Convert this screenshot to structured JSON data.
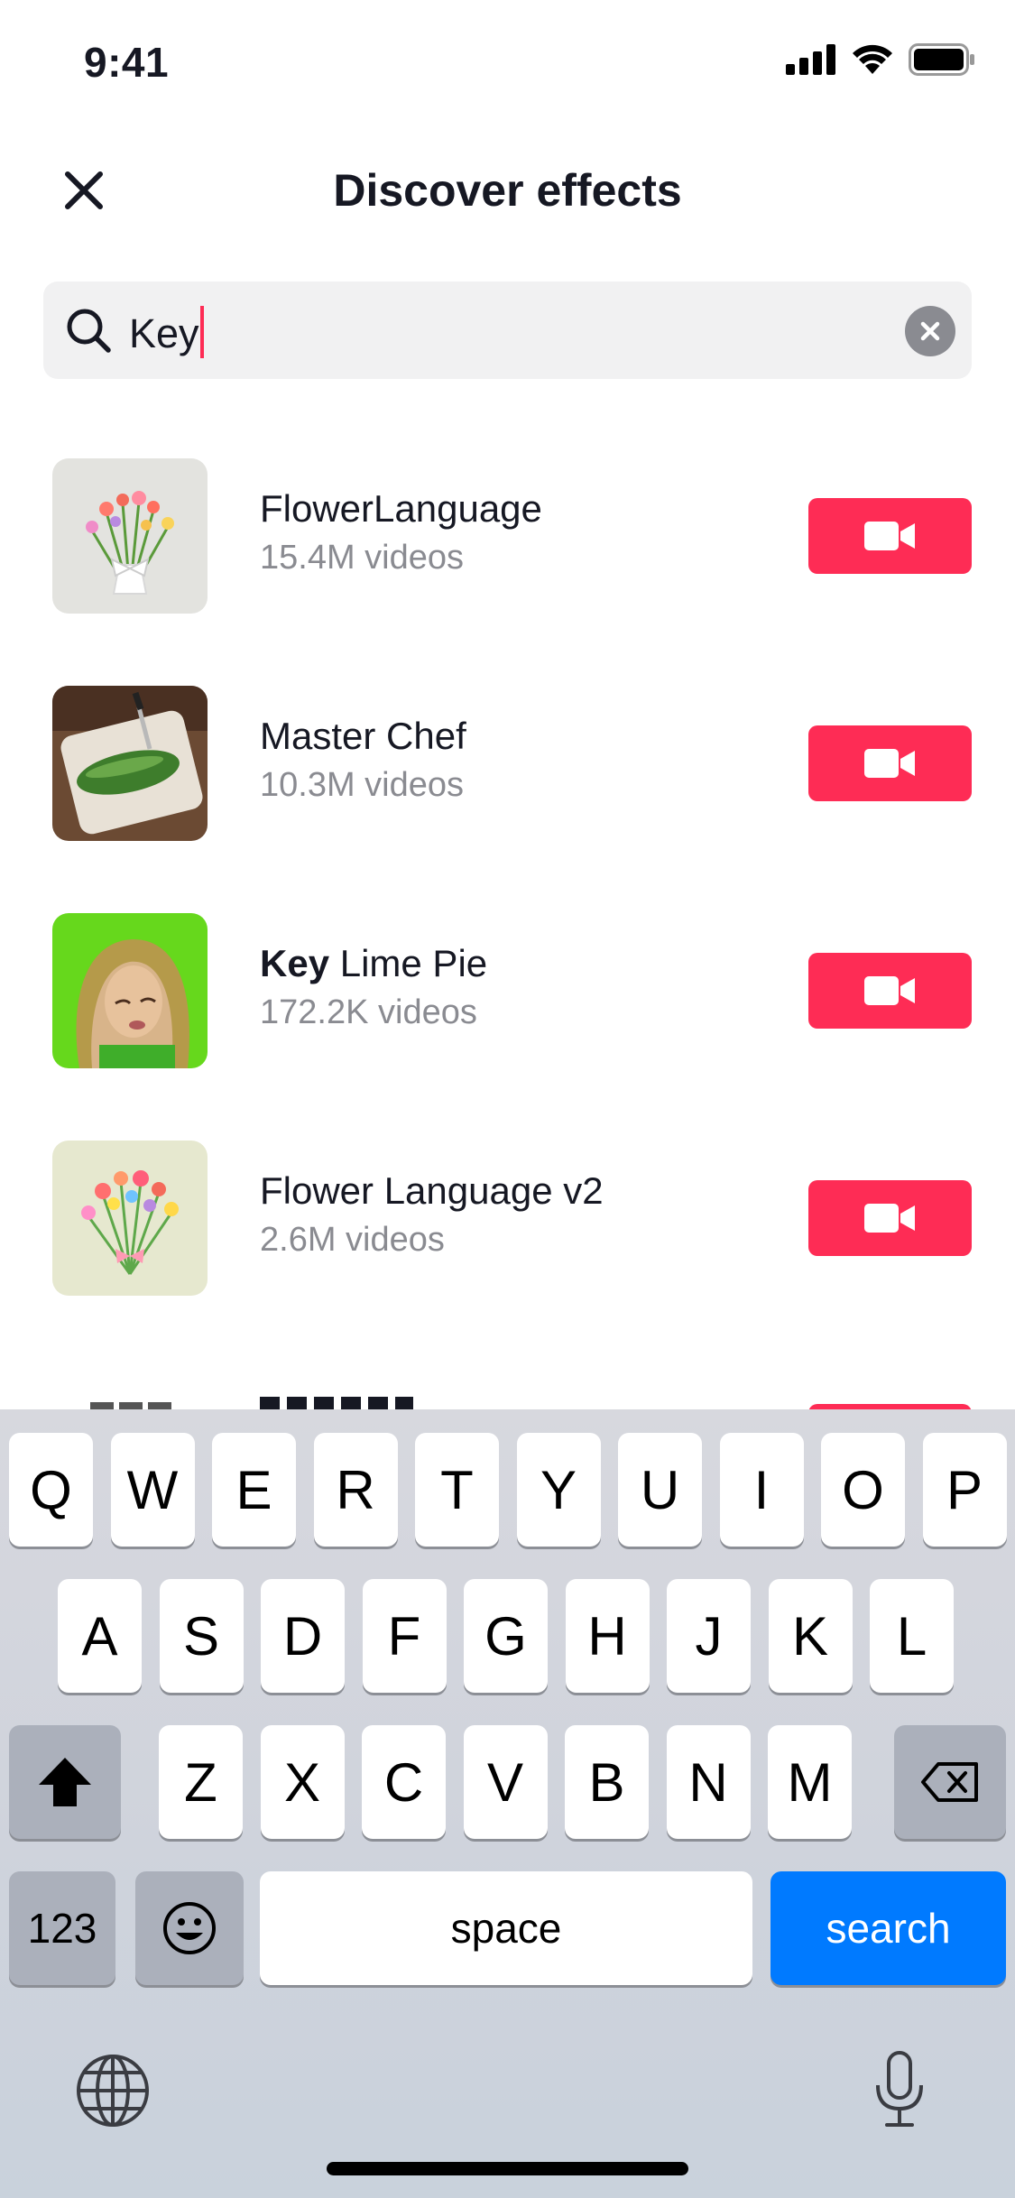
{
  "status_bar": {
    "time": "9:41"
  },
  "header": {
    "title": "Discover effects"
  },
  "search": {
    "value": "Key"
  },
  "effects": [
    {
      "name_highlight": "",
      "name_rest": "FlowerLanguage",
      "count": "15.4M videos"
    },
    {
      "name_highlight": "",
      "name_rest": "Master Chef",
      "count": "10.3M videos"
    },
    {
      "name_highlight": "Key",
      "name_rest": " Lime Pie",
      "count": "172.2K videos"
    },
    {
      "name_highlight": "",
      "name_rest": "Flower Language v2",
      "count": "2.6M videos"
    }
  ],
  "keyboard": {
    "row1": [
      "Q",
      "W",
      "E",
      "R",
      "T",
      "Y",
      "U",
      "I",
      "O",
      "P"
    ],
    "row2": [
      "A",
      "S",
      "D",
      "F",
      "G",
      "H",
      "J",
      "K",
      "L"
    ],
    "row3": [
      "Z",
      "X",
      "C",
      "V",
      "B",
      "N",
      "M"
    ],
    "numbers_label": "123",
    "space_label": "space",
    "search_label": "search"
  },
  "colors": {
    "accent": "#fe2c55",
    "keyboard_action": "#007aff",
    "secondary_text": "#8a8b91"
  },
  "icons": [
    "close-icon",
    "search-icon",
    "clear-icon",
    "video-camera-icon",
    "shift-icon",
    "backspace-icon",
    "emoji-icon",
    "globe-icon",
    "microphone-icon"
  ]
}
